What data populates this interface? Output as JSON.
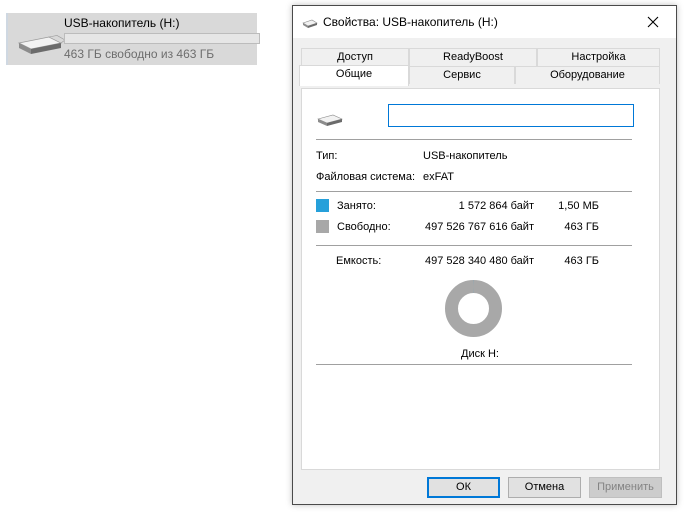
{
  "explorer_tile": {
    "drive_name": "USB-накопитель (H:)",
    "free_text": "463 ГБ свободно из 463 ГБ",
    "usage_fraction": 0.0
  },
  "dialog": {
    "title": "Свойства: USB-накопитель (H:)",
    "tabs_back_row": [
      "Доступ",
      "ReadyBoost",
      "Настройка"
    ],
    "tabs_front_row": [
      "Общие",
      "Сервис",
      "Оборудование"
    ],
    "active_tab": "Общие",
    "general": {
      "volume_label_value": "",
      "type_label": "Тип:",
      "type_value": "USB-накопитель",
      "fs_label": "Файловая система:",
      "fs_value": "exFAT",
      "used_label": "Занято:",
      "used_bytes": "1 572 864 байт",
      "used_size": "1,50 МБ",
      "free_label": "Свободно:",
      "free_bytes": "497 526 767 616 байт",
      "free_size": "463 ГБ",
      "capacity_label": "Емкость:",
      "capacity_bytes": "497 528 340 480 байт",
      "capacity_size": "463 ГБ",
      "disk_label": "Диск H:",
      "used_fraction": 3.2e-06
    },
    "buttons": {
      "ok": "ОК",
      "cancel": "Отмена",
      "apply": "Применить"
    }
  },
  "colors": {
    "used": "#26a0da",
    "free": "#a8a8a8",
    "focus": "#0078d7"
  }
}
